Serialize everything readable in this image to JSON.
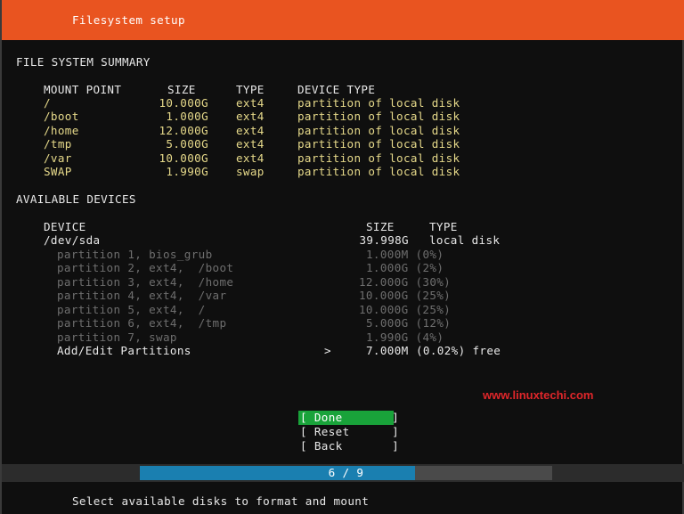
{
  "header": {
    "title": "Filesystem setup"
  },
  "summary": {
    "heading": "FILE SYSTEM SUMMARY",
    "columns": [
      "MOUNT POINT",
      "SIZE",
      "TYPE",
      "DEVICE TYPE"
    ],
    "rows": [
      {
        "mount": "/",
        "size": "10.000G",
        "type": "ext4",
        "device_type": "partition of local disk"
      },
      {
        "mount": "/boot",
        "size": "1.000G",
        "type": "ext4",
        "device_type": "partition of local disk"
      },
      {
        "mount": "/home",
        "size": "12.000G",
        "type": "ext4",
        "device_type": "partition of local disk"
      },
      {
        "mount": "/tmp",
        "size": "5.000G",
        "type": "ext4",
        "device_type": "partition of local disk"
      },
      {
        "mount": "/var",
        "size": "10.000G",
        "type": "ext4",
        "device_type": "partition of local disk"
      },
      {
        "mount": "SWAP",
        "size": "1.990G",
        "type": "swap",
        "device_type": "partition of local disk"
      }
    ]
  },
  "devices": {
    "heading": "AVAILABLE DEVICES",
    "columns": [
      "DEVICE",
      "SIZE",
      "TYPE"
    ],
    "disk": {
      "name": "/dev/sda",
      "size": "39.998G",
      "type": "local disk"
    },
    "partitions": [
      {
        "label": "partition 1, bios_grub",
        "size": "1.000M (0%)"
      },
      {
        "label": "partition 2, ext4,  /boot",
        "size": "1.000G (2%)"
      },
      {
        "label": "partition 3, ext4,  /home",
        "size": "12.000G (30%)"
      },
      {
        "label": "partition 4, ext4,  /var",
        "size": "10.000G (25%)"
      },
      {
        "label": "partition 5, ext4,  /",
        "size": "10.000G (25%)"
      },
      {
        "label": "partition 6, ext4,  /tmp",
        "size": "5.000G (12%)"
      },
      {
        "label": "partition 7, swap",
        "size": "1.990G (4%)"
      }
    ],
    "add_edit": {
      "label": "Add/Edit Partitions",
      "arrow": ">",
      "size": "7.000M",
      "free": "(0.02%) free"
    }
  },
  "watermark": "www.linuxtechi.com",
  "buttons": {
    "done": "[ Done       ]",
    "reset": "[ Reset      ]",
    "back": "[ Back       ]"
  },
  "progress": {
    "text": "6 / 9",
    "current": 6,
    "total": 9
  },
  "footer": "Select available disks to format and mount",
  "colors": {
    "header": "#e95420",
    "done_button": "#19a33a",
    "progress_fill": "#1a7fb0",
    "watermark": "#e0262a"
  }
}
